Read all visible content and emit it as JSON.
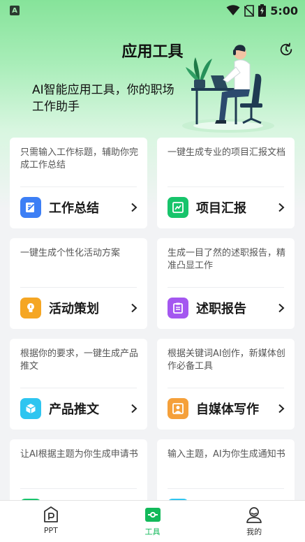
{
  "status_bar": {
    "left_icon": "A",
    "icons": [
      "wifi-icon",
      "no-sim-icon",
      "battery-charging-icon"
    ],
    "time": "5:00"
  },
  "header": {
    "title": "应用工具",
    "history_icon": "history-icon",
    "tagline": "AI智能应用工具，你的职场工作助手"
  },
  "cards": [
    {
      "desc": "只需输入工作标题，辅助你完成工作总结",
      "title": "工作总结",
      "icon": "document-edit-icon",
      "color": "#3d7ff5"
    },
    {
      "desc": "一键生成专业的项目汇报文档",
      "title": "项目汇报",
      "icon": "report-chart-icon",
      "color": "#17c46b"
    },
    {
      "desc": "一键生成个性化活动方案",
      "title": "活动策划",
      "icon": "lightbulb-icon",
      "color": "#f5a623"
    },
    {
      "desc": "生成一目了然的述职报告，精准凸显工作",
      "title": "述职报告",
      "icon": "clipboard-list-icon",
      "color": "#a457f0"
    },
    {
      "desc": "根据你的要求，一键生成产品推文",
      "title": "产品推文",
      "icon": "cube-icon",
      "color": "#2ec5f0"
    },
    {
      "desc": "根据关键词AI创作，新媒体创作必备工具",
      "title": "自媒体写作",
      "icon": "person-card-icon",
      "color": "#f5a03a"
    },
    {
      "desc": "让AI根据主题为你生成申请书",
      "title": "",
      "icon": "green-doc-icon",
      "color": "#17c46b"
    },
    {
      "desc": "输入主题，AI为你生成通知书",
      "title": "",
      "icon": "cyan-doc-icon",
      "color": "#2ec5f0"
    }
  ],
  "bottom_nav": [
    {
      "label": "PPT",
      "icon": "ppt-icon",
      "active": false
    },
    {
      "label": "工具",
      "icon": "tools-icon",
      "active": true
    },
    {
      "label": "我的",
      "icon": "profile-icon",
      "active": false
    }
  ],
  "accent_color": "#12b95a"
}
